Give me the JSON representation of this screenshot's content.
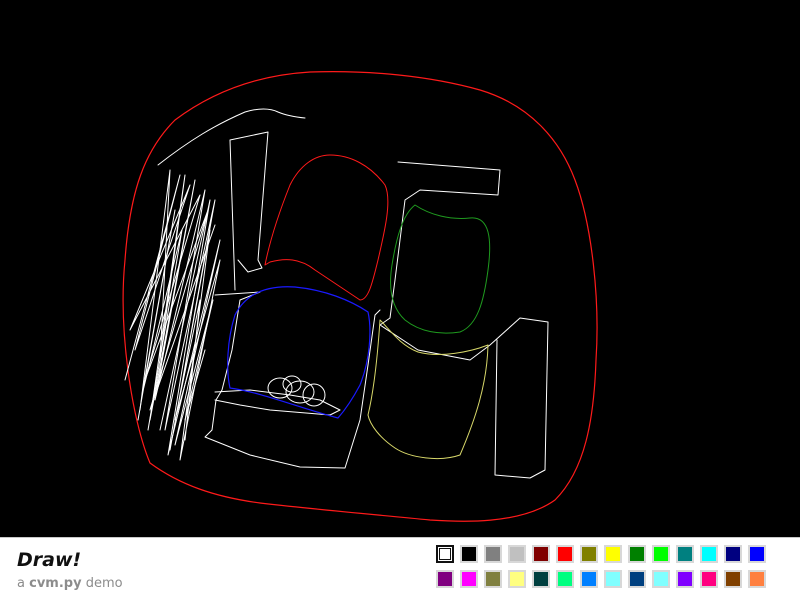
{
  "app": {
    "title": "Draw!",
    "subtitle_prefix": "a",
    "subtitle_name": "cvm.py",
    "subtitle_suffix": "demo"
  },
  "canvas": {
    "background": "#000000"
  },
  "palette": {
    "selected_index": 0,
    "colors": [
      "#ffffff",
      "#000000",
      "#808080",
      "#c0c0c0",
      "#800000",
      "#ff0000",
      "#808000",
      "#ffff00",
      "#008000",
      "#00ff00",
      "#008080",
      "#00ffff",
      "#000080",
      "#0000ff",
      "#800080",
      "#ff00ff",
      "#808040",
      "#ffff80",
      "#004040",
      "#00ff80",
      "#0080ff",
      "#80ffff",
      "#004080",
      "#80ffff",
      "#8000ff",
      "#ff0080",
      "#804000",
      "#ff8040"
    ]
  }
}
